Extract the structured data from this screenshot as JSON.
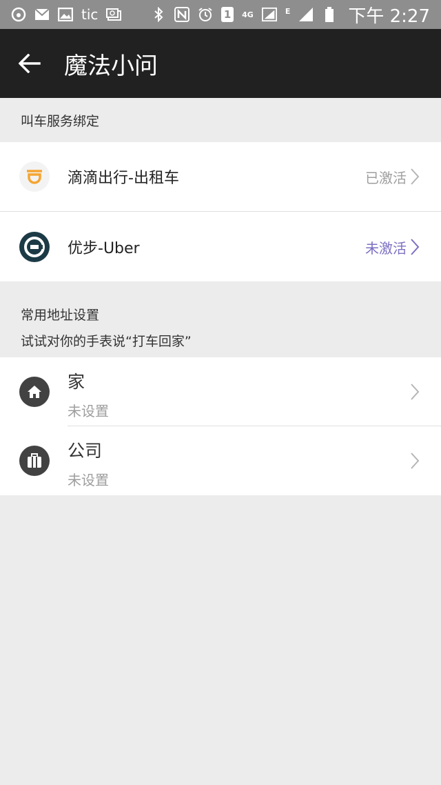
{
  "status_bar": {
    "left_text": "tic",
    "sim_label": "1",
    "network_label": "4G",
    "edge_label": "E",
    "time": "下午 2:27"
  },
  "app_bar": {
    "title": "魔法小问"
  },
  "ride_section": {
    "header": "叫车服务绑定",
    "items": [
      {
        "name": "滴滴出行-出租车",
        "status": "已激活",
        "status_color": "#9e9e9e",
        "icon": "didi-icon"
      },
      {
        "name": "优步-Uber",
        "status": "未激活",
        "status_color": "#7b6fc2",
        "icon": "uber-icon"
      }
    ]
  },
  "address_section": {
    "header": "常用地址设置",
    "hint": "试试对你的手表说“打车回家”",
    "items": [
      {
        "name": "家",
        "value": "未设置",
        "icon": "home-icon"
      },
      {
        "name": "公司",
        "value": "未设置",
        "icon": "briefcase-icon"
      }
    ]
  },
  "colors": {
    "app_bar": "#212121",
    "status_bar": "#8e8e8e",
    "background": "#ececec",
    "didi_orange": "#f5a531",
    "uber_dark": "#1b3a46"
  }
}
